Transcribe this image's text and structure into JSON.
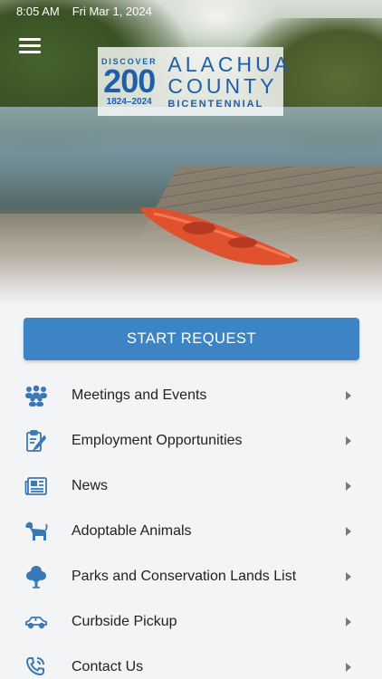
{
  "status_bar": {
    "time": "8:05 AM",
    "date": "Fri Mar 1, 2024"
  },
  "logo": {
    "discover": "DISCOVER",
    "number": "200",
    "years": "1824–2024",
    "name_line1": "ALACHUA",
    "name_line2": "COUNTY",
    "bicentennial": "BICENTENNIAL"
  },
  "start_request_label": "START REQUEST",
  "menu": {
    "items": [
      {
        "label": "Meetings and Events",
        "icon": "people-group-icon"
      },
      {
        "label": "Employment Opportunities",
        "icon": "clipboard-edit-icon"
      },
      {
        "label": "News",
        "icon": "newspaper-icon"
      },
      {
        "label": "Adoptable Animals",
        "icon": "dog-icon"
      },
      {
        "label": "Parks and Conservation Lands List",
        "icon": "tree-icon"
      },
      {
        "label": "Curbside Pickup",
        "icon": "car-icon"
      },
      {
        "label": "Contact Us",
        "icon": "phone-chat-icon"
      }
    ]
  },
  "colors": {
    "accent": "#3d84c5",
    "icon": "#3b78b6",
    "background": "#f3f4f6"
  }
}
